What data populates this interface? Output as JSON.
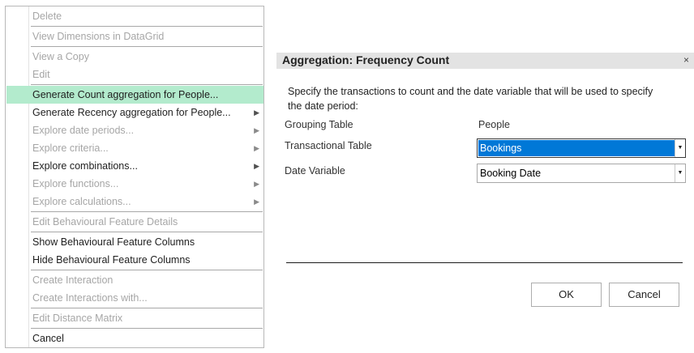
{
  "menu": {
    "items": [
      {
        "label": "Delete",
        "state": "disabled"
      },
      {
        "label": "View Dimensions in DataGrid",
        "state": "disabled"
      },
      {
        "label": "View a Copy",
        "state": "disabled"
      },
      {
        "label": "Edit",
        "state": "disabled"
      },
      {
        "label": "Generate Count aggregation for People...",
        "state": "highlighted"
      },
      {
        "label": "Generate Recency aggregation for People...",
        "state": "enabled"
      },
      {
        "label": "Explore date periods...",
        "state": "disabled"
      },
      {
        "label": "Explore criteria...",
        "state": "disabled"
      },
      {
        "label": "Explore combinations...",
        "state": "enabled"
      },
      {
        "label": "Explore functions...",
        "state": "disabled"
      },
      {
        "label": "Explore calculations...",
        "state": "disabled"
      },
      {
        "label": "Edit Behavioural Feature Details",
        "state": "disabled"
      },
      {
        "label": "Show Behavioural Feature Columns",
        "state": "enabled"
      },
      {
        "label": "Hide Behavioural Feature Columns",
        "state": "enabled"
      },
      {
        "label": "Create Interaction",
        "state": "disabled"
      },
      {
        "label": "Create Interactions with...",
        "state": "disabled"
      },
      {
        "label": "Edit Distance Matrix",
        "state": "disabled"
      },
      {
        "label": "Cancel",
        "state": "enabled"
      }
    ],
    "submenu_arrow": "▶"
  },
  "dialog": {
    "title": "Aggregation: Frequency Count",
    "close_glyph": "×",
    "description": "Specify the transactions to count and the date variable that will be used to specify the date period:",
    "grouping_table_label": "Grouping Table",
    "grouping_table_value": "People",
    "transactional_table_label": "Transactional Table",
    "transactional_table_value": "Bookings",
    "date_variable_label": "Date Variable",
    "date_variable_value": "Booking Date",
    "dropdown_glyph": "▼",
    "ok_label": "OK",
    "cancel_label": "Cancel"
  },
  "colors": {
    "highlight": "#b3ebcd",
    "selection": "#0078d7",
    "disabled_text": "#a6a6a6"
  }
}
